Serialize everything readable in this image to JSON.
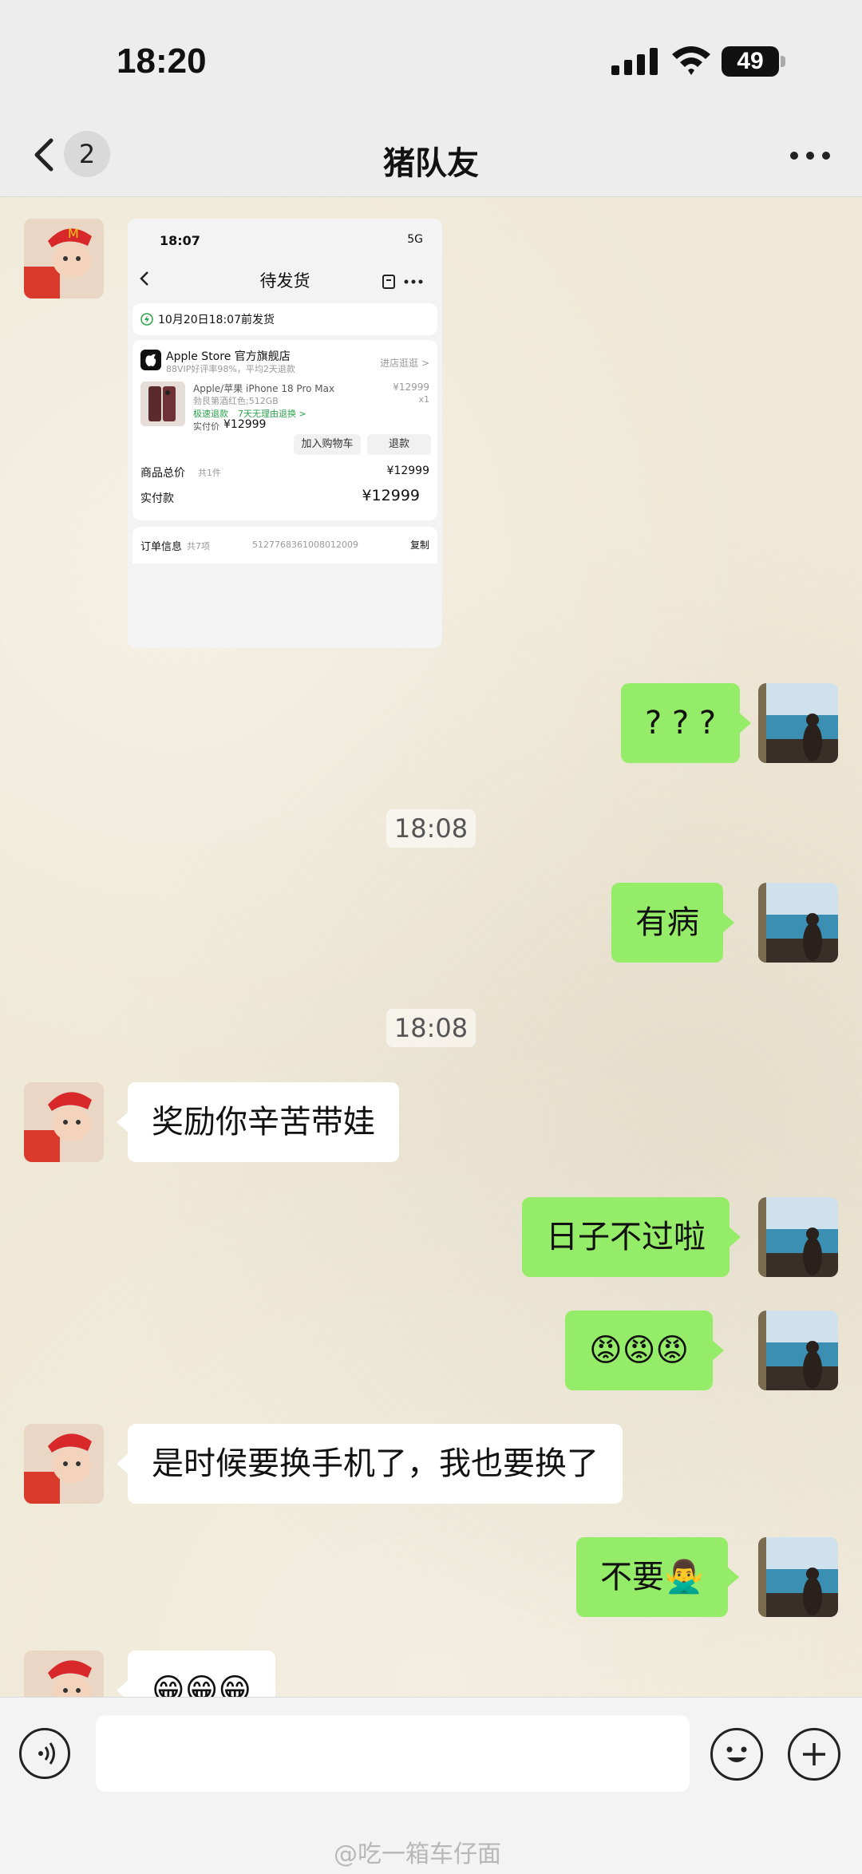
{
  "status_bar": {
    "time": "18:20",
    "battery": "49"
  },
  "nav": {
    "unread_count": "2",
    "title": "猪队友"
  },
  "screenshot": {
    "time": "18:07",
    "network": "5G",
    "title": "待发货",
    "notice": "10月20日18:07前发货",
    "store_name": "Apple Store 官方旗舰店",
    "store_sub": "88VIP好评率98%，平均2天退款",
    "store_link": "进店逛逛 >",
    "product_name": "Apple/苹果 iPhone 18 Pro Max",
    "product_price": "¥12999",
    "product_spec": "勃艮第酒红色;512GB",
    "product_qty": "x1",
    "tags_fast": "极速退款",
    "tags_return": "7天无理由退换 >",
    "paid_label": "实付价",
    "paid_value": "¥12999",
    "btn_cart": "加入购物车",
    "btn_refund": "退款",
    "total_label": "商品总价",
    "total_count": "共1件",
    "total_value": "¥12999",
    "pay_label": "实付款",
    "pay_value": "¥12999",
    "order_label": "订单信息",
    "order_count": "共7项",
    "order_no": "5127768361008012009",
    "copy": "复制"
  },
  "messages": {
    "m1": "? ? ?",
    "ts1": "18:08",
    "m2": "有病",
    "ts2": "18:08",
    "m3": "奖励你辛苦带娃",
    "m4": "日子不过啦",
    "m5": "😡😡😡",
    "m6": "是时候要换手机了，我也要换了",
    "m7": "不要🙅‍♂️",
    "m8": "😁😁😁"
  },
  "watermark": "@吃一箱车仔面"
}
